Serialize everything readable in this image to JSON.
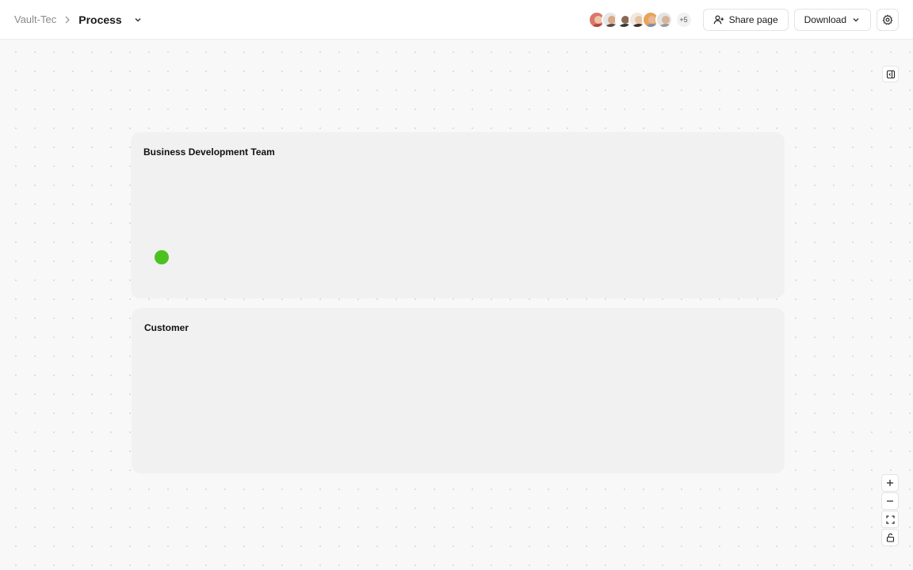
{
  "breadcrumb": {
    "parent": "Vault-Tec",
    "current": "Process"
  },
  "header": {
    "avatars": [
      {
        "name": "avatar-1",
        "bg": "#d9776a",
        "skin": "#f0c4a8",
        "shirt": "#b5483c"
      },
      {
        "name": "avatar-2",
        "bg": "#e6e6e6",
        "skin": "#d8a888",
        "shirt": "#5b4a3f"
      },
      {
        "name": "avatar-3",
        "bg": "#ffffff",
        "skin": "#8a6a55",
        "shirt": "#2f3a3a"
      },
      {
        "name": "avatar-4",
        "bg": "#f0e8e0",
        "skin": "#e6c3a5",
        "shirt": "#3b2f2a"
      },
      {
        "name": "avatar-5",
        "bg": "#e8a45a",
        "skin": "#e9b896",
        "shirt": "#7a8fb0"
      },
      {
        "name": "avatar-6",
        "bg": "#e4e4e4",
        "skin": "#d7b39a",
        "shirt": "#9a9a9a"
      }
    ],
    "more_count": "+5",
    "share_label": "Share page",
    "download_label": "Download"
  },
  "lanes": [
    {
      "title": "Business Development Team"
    },
    {
      "title": "Customer"
    }
  ],
  "colors": {
    "start_node": "#4cc21f",
    "lane_bg": "#f1f1f1",
    "canvas_bg": "#f8f8f8"
  }
}
